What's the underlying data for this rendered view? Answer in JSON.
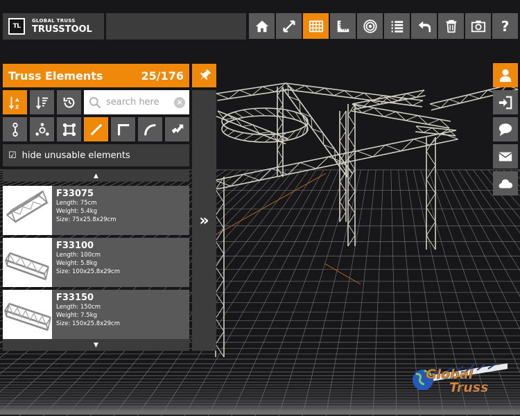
{
  "app": {
    "logo_mark": "TL",
    "brand_line": "GLOBAL TRUSS",
    "product": "TRUSSTOOL"
  },
  "toolbar": {
    "buttons": [
      {
        "icon": "home-icon",
        "active": false
      },
      {
        "icon": "fullscreen-icon",
        "active": false
      },
      {
        "icon": "grid-icon",
        "active": true
      },
      {
        "icon": "ruler-icon",
        "active": false
      },
      {
        "icon": "target-icon",
        "active": false
      },
      {
        "icon": "list-icon",
        "active": false
      },
      {
        "icon": "undo-icon",
        "active": false
      },
      {
        "icon": "trash-icon",
        "active": false
      },
      {
        "icon": "camera-icon",
        "active": false
      },
      {
        "icon": "help-icon",
        "active": false,
        "glyph": "?"
      }
    ]
  },
  "panel": {
    "title": "Truss Elements",
    "count": "25/176",
    "search": {
      "placeholder": "search here",
      "value": ""
    },
    "hide_label": "hide unusable elements",
    "scroll_up": "▲",
    "scroll_down": "▼",
    "expand_glyph": "»",
    "items": [
      {
        "name": "F33075",
        "length": "Length: 75cm",
        "weight": "Weight: 5.4kg",
        "size": "Size: 75x25.8x29cm"
      },
      {
        "name": "F33100",
        "length": "Length: 100cm",
        "weight": "Weight: 5.8kg",
        "size": "Size: 100x25.8x29cm"
      },
      {
        "name": "F33150",
        "length": "Length: 150cm",
        "weight": "Weight: 7.5kg",
        "size": "Size: 150x25.8x29cm"
      }
    ]
  },
  "side_buttons": [
    {
      "icon": "user-icon",
      "active": true
    },
    {
      "icon": "login-icon",
      "active": false
    },
    {
      "icon": "chat-icon",
      "active": false
    },
    {
      "icon": "mail-icon",
      "active": false
    },
    {
      "icon": "cloud-icon",
      "active": false
    }
  ],
  "brand": {
    "line1": "Global",
    "line2": "Truss"
  },
  "colors": {
    "accent": "#f0880a",
    "panel": "#3c3c3c",
    "button": "#595959",
    "background": "#17171a",
    "truss": "#d2d2c6"
  }
}
